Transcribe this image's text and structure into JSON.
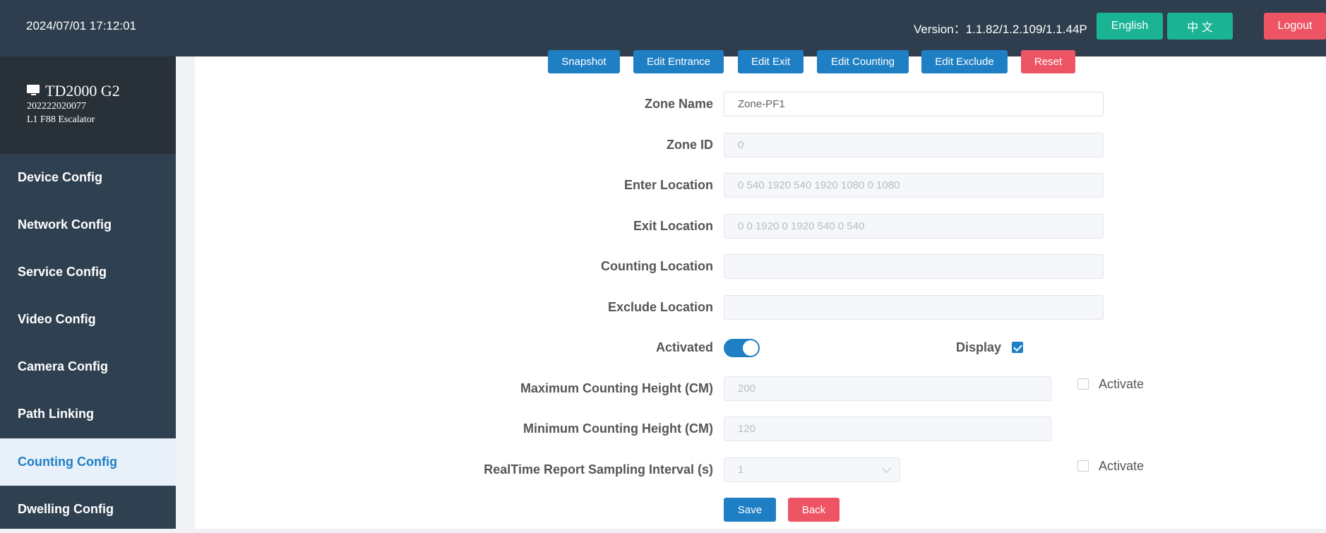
{
  "header": {
    "datetime": "2024/07/01 17:12:01",
    "version": "Version：1.1.82/1.2.109/1.1.44P",
    "lang_english": "English",
    "lang_chinese": "中 文",
    "logout": "Logout"
  },
  "device": {
    "name": "TD2000 G2",
    "serial": "202222020077",
    "location": "L1 F88 Escalator",
    "icon": "monitor-icon"
  },
  "sidebar": {
    "items": [
      {
        "label": "Device Config"
      },
      {
        "label": "Network Config"
      },
      {
        "label": "Service Config"
      },
      {
        "label": "Video Config"
      },
      {
        "label": "Camera Config"
      },
      {
        "label": "Path Linking"
      },
      {
        "label": "Counting Config",
        "active": true
      },
      {
        "label": "Dwelling Config"
      }
    ]
  },
  "toolbar": {
    "snapshot": "Snapshot",
    "edit_entrance": "Edit Entrance",
    "edit_exit": "Edit Exit",
    "edit_counting": "Edit Counting",
    "edit_exclude": "Edit Exclude",
    "reset": "Reset"
  },
  "form": {
    "zone_name": {
      "label": "Zone Name",
      "value": "Zone-PF1"
    },
    "zone_id": {
      "label": "Zone ID",
      "value": "0"
    },
    "enter_location": {
      "label": "Enter Location",
      "value": "0 540 1920 540 1920 1080 0 1080"
    },
    "exit_location": {
      "label": "Exit Location",
      "value": "0 0 1920 0 1920 540 0 540"
    },
    "counting_location": {
      "label": "Counting Location",
      "value": ""
    },
    "exclude_location": {
      "label": "Exclude Location",
      "value": ""
    },
    "activated": {
      "label": "Activated",
      "on": true
    },
    "display": {
      "label": "Display",
      "checked": true
    },
    "max_height": {
      "label": "Maximum Counting Height (CM)",
      "value": "200",
      "activate_label": "Activate",
      "activate_checked": false
    },
    "min_height": {
      "label": "Minimum Counting Height (CM)",
      "value": "120"
    },
    "sampling_interval": {
      "label": "RealTime Report Sampling Interval (s)",
      "value": "1",
      "activate_label": "Activate",
      "activate_checked": false
    },
    "save": "Save",
    "back": "Back"
  },
  "colors": {
    "topbar": "#2e3e4e",
    "sidebar": "#2f4050",
    "primary": "#1f7fc4",
    "green": "#1ab394",
    "red": "#ed5565"
  }
}
